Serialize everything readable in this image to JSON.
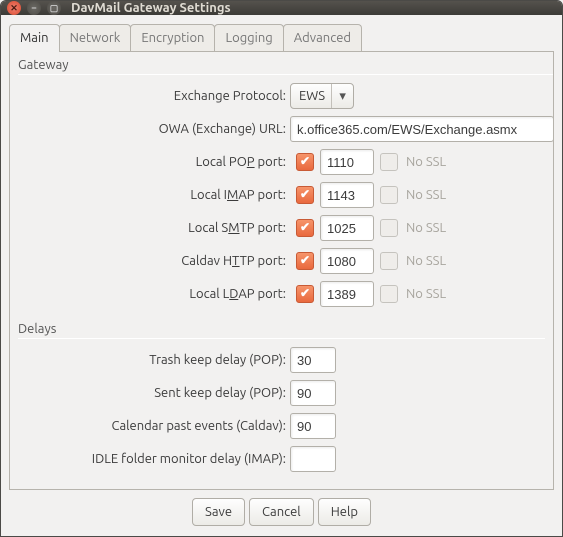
{
  "window": {
    "title": "DavMail Gateway Settings"
  },
  "tabs": [
    {
      "label": "Main"
    },
    {
      "label": "Network"
    },
    {
      "label": "Encryption"
    },
    {
      "label": "Logging"
    },
    {
      "label": "Advanced"
    }
  ],
  "gateway": {
    "legend": "Gateway",
    "protocol_label": "Exchange Protocol:",
    "protocol_value": "EWS",
    "url_label": "OWA (Exchange) URL:",
    "url_value": "k.office365.com/EWS/Exchange.asmx",
    "nossl_text": "No SSL",
    "ports": [
      {
        "pre": "Local PO",
        "mn": "P",
        "post": " port:",
        "value": "1110"
      },
      {
        "pre": "Local I",
        "mn": "M",
        "post": "AP port:",
        "value": "1143"
      },
      {
        "pre": "Local S",
        "mn": "M",
        "post": "TP port:",
        "value": "1025"
      },
      {
        "pre": "Caldav H",
        "mn": "T",
        "post": "TP port:",
        "value": "1080"
      },
      {
        "pre": "Local L",
        "mn": "D",
        "post": "AP port:",
        "value": "1389"
      }
    ]
  },
  "delays": {
    "legend": "Delays",
    "rows": [
      {
        "label": "Trash keep delay (POP):",
        "value": "30"
      },
      {
        "label": "Sent keep delay (POP):",
        "value": "90"
      },
      {
        "label": "Calendar past events (Caldav):",
        "value": "90"
      },
      {
        "label": "IDLE folder monitor delay (IMAP):",
        "value": ""
      }
    ]
  },
  "buttons": {
    "save": "Save",
    "cancel": "Cancel",
    "help": "Help"
  }
}
